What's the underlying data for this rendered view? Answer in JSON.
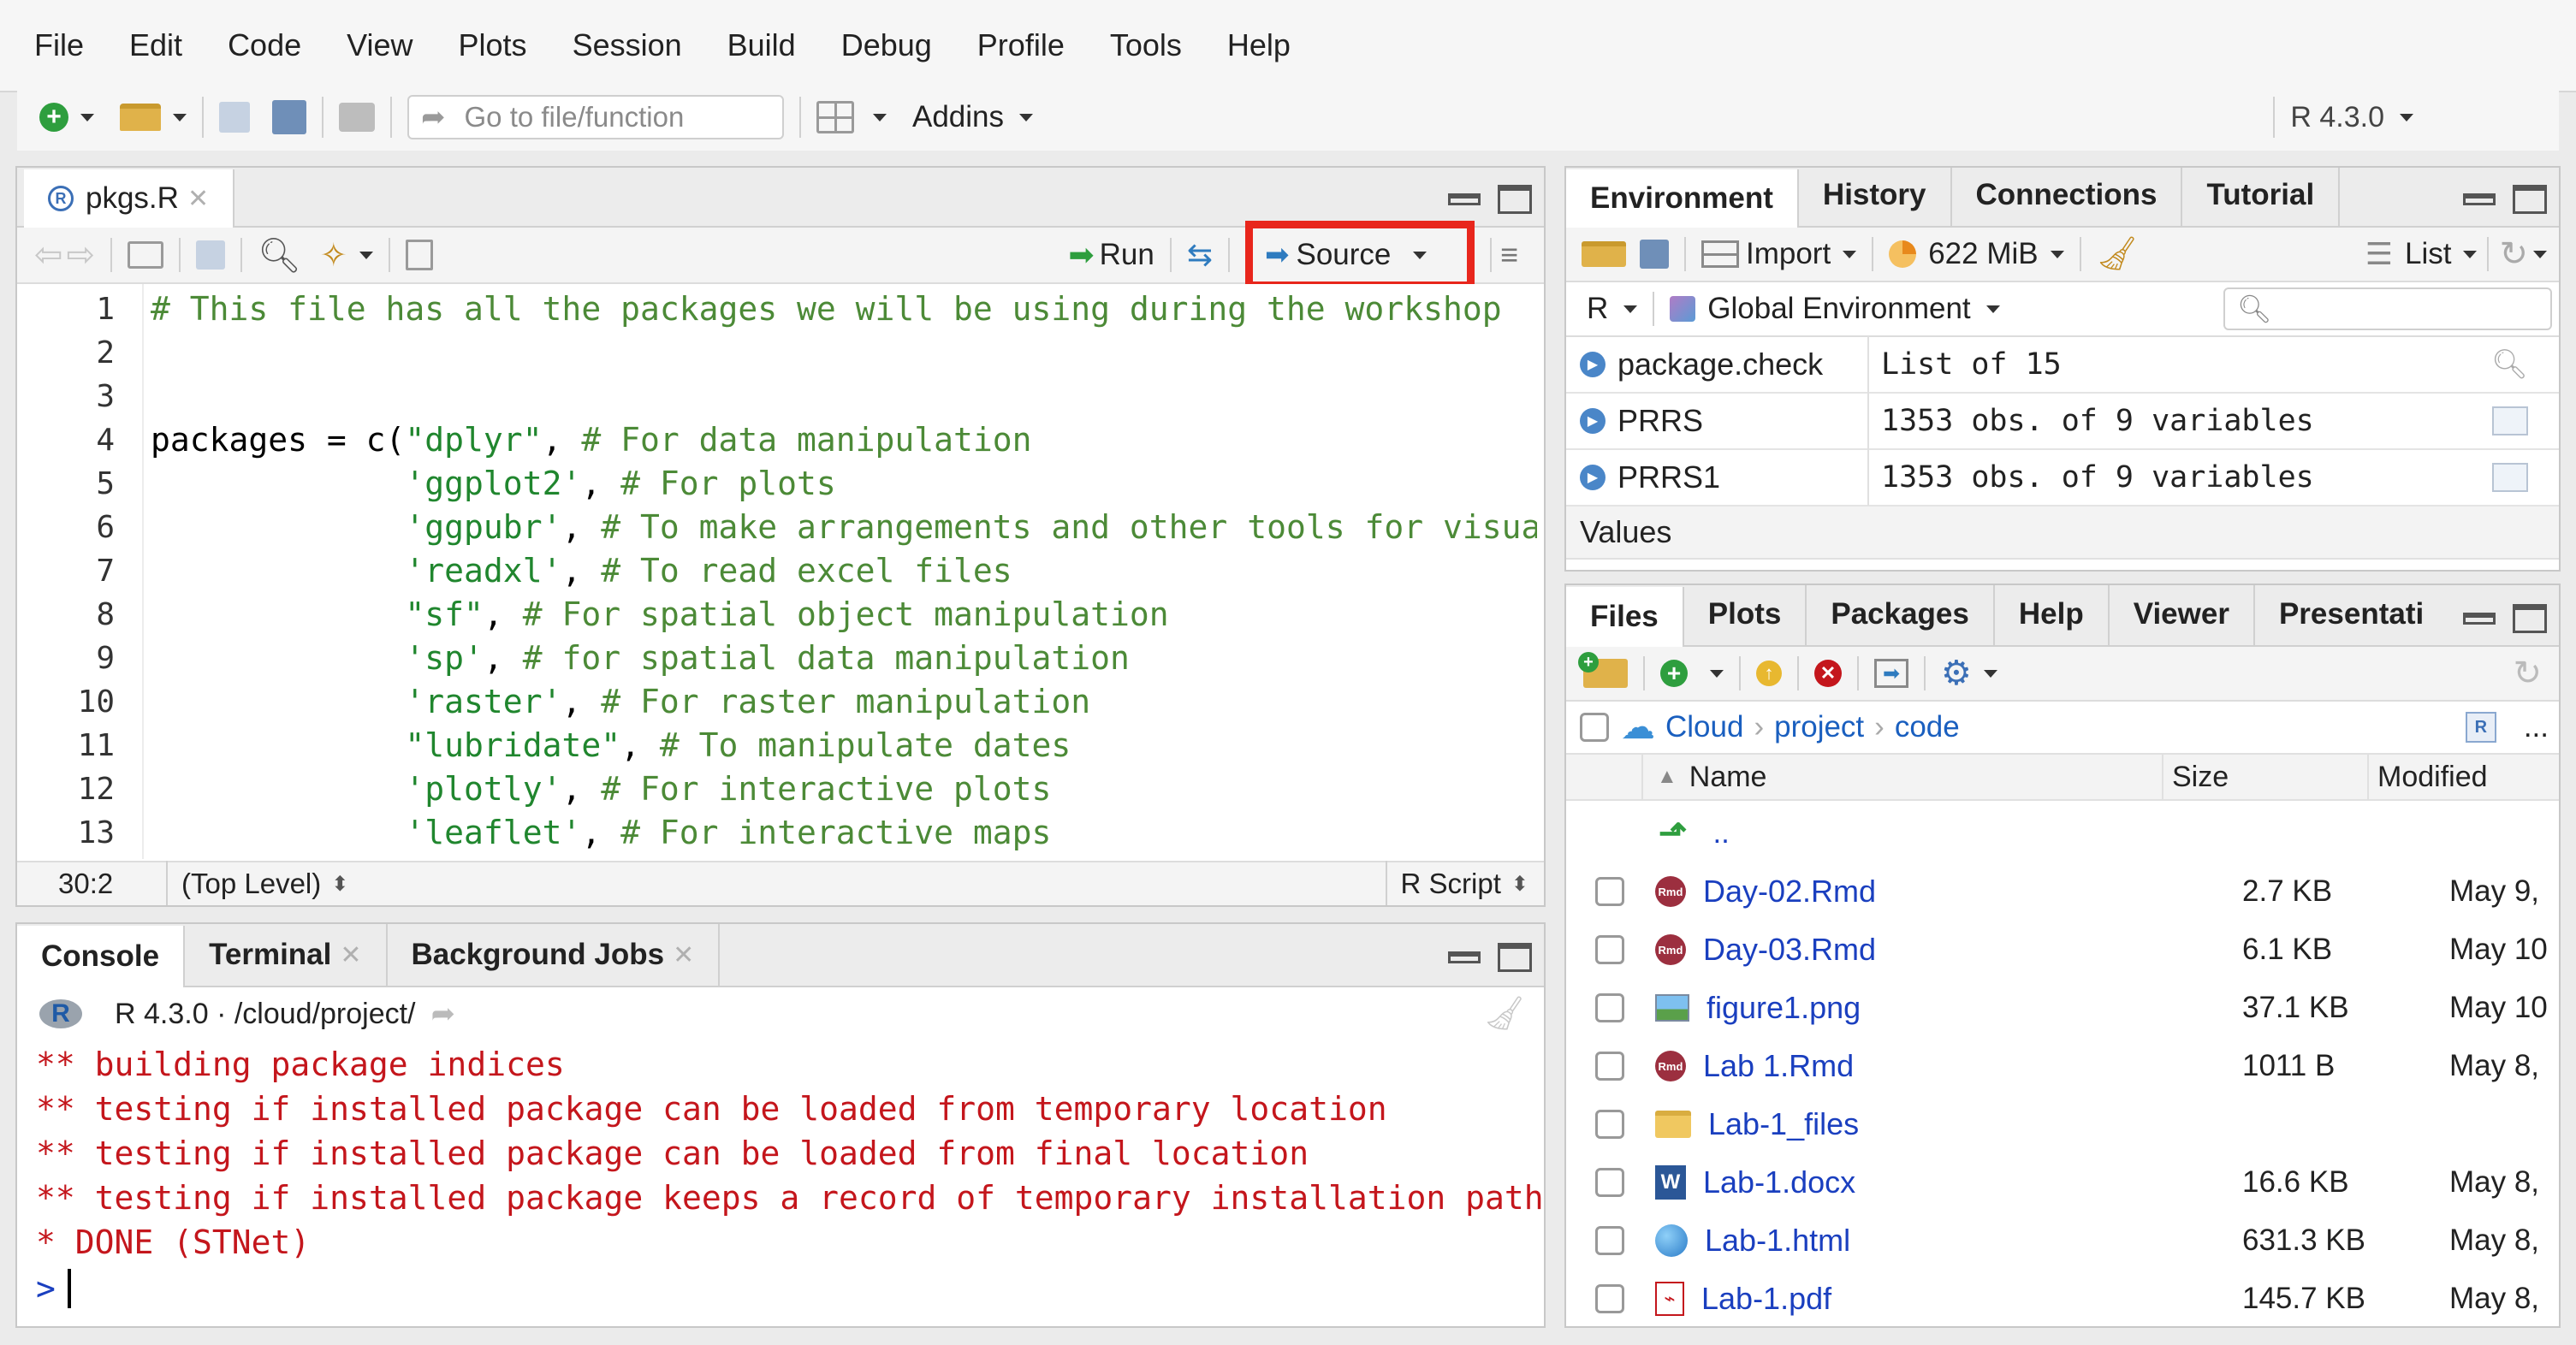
{
  "menu": [
    "File",
    "Edit",
    "Code",
    "View",
    "Plots",
    "Session",
    "Build",
    "Debug",
    "Profile",
    "Tools",
    "Help"
  ],
  "toolbar": {
    "goto_placeholder": "Go to file/function",
    "addins": "Addins",
    "r_version": "R 4.3.0"
  },
  "editor": {
    "tab": "pkgs.R",
    "run": "Run",
    "source": "Source",
    "lines": [
      {
        "n": "1",
        "parts": [
          {
            "t": "# This file has all the packages we will be using during the workshop",
            "c": "com"
          }
        ]
      },
      {
        "n": "2",
        "parts": []
      },
      {
        "n": "3",
        "parts": []
      },
      {
        "n": "4",
        "parts": [
          {
            "t": "packages = c(",
            "c": "txt"
          },
          {
            "t": "\"dplyr\"",
            "c": "str"
          },
          {
            "t": ", ",
            "c": "txt"
          },
          {
            "t": "# For data manipulation",
            "c": "com"
          }
        ]
      },
      {
        "n": "5",
        "parts": [
          {
            "t": "             ",
            "c": "txt"
          },
          {
            "t": "'ggplot2'",
            "c": "str"
          },
          {
            "t": ", ",
            "c": "txt"
          },
          {
            "t": "# For plots",
            "c": "com"
          }
        ]
      },
      {
        "n": "6",
        "parts": [
          {
            "t": "             ",
            "c": "txt"
          },
          {
            "t": "'ggpubr'",
            "c": "str"
          },
          {
            "t": ", ",
            "c": "txt"
          },
          {
            "t": "# To make arrangements and other tools for visualiza",
            "c": "com"
          }
        ]
      },
      {
        "n": "7",
        "parts": [
          {
            "t": "             ",
            "c": "txt"
          },
          {
            "t": "'readxl'",
            "c": "str"
          },
          {
            "t": ", ",
            "c": "txt"
          },
          {
            "t": "# To read excel files",
            "c": "com"
          }
        ]
      },
      {
        "n": "8",
        "parts": [
          {
            "t": "             ",
            "c": "txt"
          },
          {
            "t": "\"sf\"",
            "c": "str"
          },
          {
            "t": ", ",
            "c": "txt"
          },
          {
            "t": "# For spatial object manipulation",
            "c": "com"
          }
        ]
      },
      {
        "n": "9",
        "parts": [
          {
            "t": "             ",
            "c": "txt"
          },
          {
            "t": "'sp'",
            "c": "str"
          },
          {
            "t": ", ",
            "c": "txt"
          },
          {
            "t": "# for spatial data manipulation",
            "c": "com"
          }
        ]
      },
      {
        "n": "10",
        "parts": [
          {
            "t": "             ",
            "c": "txt"
          },
          {
            "t": "'raster'",
            "c": "str"
          },
          {
            "t": ", ",
            "c": "txt"
          },
          {
            "t": "# For raster manipulation",
            "c": "com"
          }
        ]
      },
      {
        "n": "11",
        "parts": [
          {
            "t": "             ",
            "c": "txt"
          },
          {
            "t": "\"lubridate\"",
            "c": "str"
          },
          {
            "t": ", ",
            "c": "txt"
          },
          {
            "t": "# To manipulate dates",
            "c": "com"
          }
        ]
      },
      {
        "n": "12",
        "parts": [
          {
            "t": "             ",
            "c": "txt"
          },
          {
            "t": "'plotly'",
            "c": "str"
          },
          {
            "t": ", ",
            "c": "txt"
          },
          {
            "t": "# For interactive plots",
            "c": "com"
          }
        ]
      },
      {
        "n": "13",
        "parts": [
          {
            "t": "             ",
            "c": "txt"
          },
          {
            "t": "'leaflet'",
            "c": "str"
          },
          {
            "t": ", ",
            "c": "txt"
          },
          {
            "t": "# For interactive maps",
            "c": "com"
          }
        ]
      }
    ],
    "status_pos": "30:2",
    "status_scope": "(Top Level)",
    "status_type": "R Script"
  },
  "console": {
    "tabs": [
      "Console",
      "Terminal",
      "Background Jobs"
    ],
    "header": "R 4.3.0 · /cloud/project/",
    "lines": [
      "** building package indices",
      "** testing if installed package can be loaded from temporary location",
      "** testing if installed package can be loaded from final location",
      "** testing if installed package keeps a record of temporary installation path",
      "* DONE (STNet)"
    ],
    "prompt": ">"
  },
  "env": {
    "tabs": [
      "Environment",
      "History",
      "Connections",
      "Tutorial"
    ],
    "import": "Import",
    "memory": "622 MiB",
    "view_mode": "List",
    "lang": "R",
    "scope": "Global Environment",
    "rows": [
      {
        "name": "package.check",
        "value": "List of  15"
      },
      {
        "name": "PRRS",
        "value": "1353 obs. of 9 variables"
      },
      {
        "name": "PRRS1",
        "value": "1353 obs. of 9 variables"
      }
    ],
    "values_header": "Values"
  },
  "files": {
    "tabs": [
      "Files",
      "Plots",
      "Packages",
      "Help",
      "Viewer",
      "Presentati"
    ],
    "breadcrumb": [
      "Cloud",
      "project",
      "code"
    ],
    "more": "...",
    "col_name": "Name",
    "col_size": "Size",
    "col_modified": "Modified",
    "up": "..",
    "rows": [
      {
        "name": "Day-02.Rmd",
        "size": "2.7 KB",
        "mod": "May 9,",
        "kind": "rmd"
      },
      {
        "name": "Day-03.Rmd",
        "size": "6.1 KB",
        "mod": "May 10",
        "kind": "rmd"
      },
      {
        "name": "figure1.png",
        "size": "37.1 KB",
        "mod": "May 10",
        "kind": "png"
      },
      {
        "name": "Lab 1.Rmd",
        "size": "1011 B",
        "mod": "May 8,",
        "kind": "rmd"
      },
      {
        "name": "Lab-1_files",
        "size": "",
        "mod": "",
        "kind": "folder"
      },
      {
        "name": "Lab-1.docx",
        "size": "16.6 KB",
        "mod": "May 8,",
        "kind": "docx"
      },
      {
        "name": "Lab-1.html",
        "size": "631.3 KB",
        "mod": "May 8,",
        "kind": "html"
      },
      {
        "name": "Lab-1.pdf",
        "size": "145.7 KB",
        "mod": "May 8,",
        "kind": "pdf"
      }
    ]
  },
  "colors": {
    "highlight": "#e8261c",
    "link": "#1a3fbf",
    "console_red": "#c4161c",
    "comment": "#4c8a37"
  }
}
